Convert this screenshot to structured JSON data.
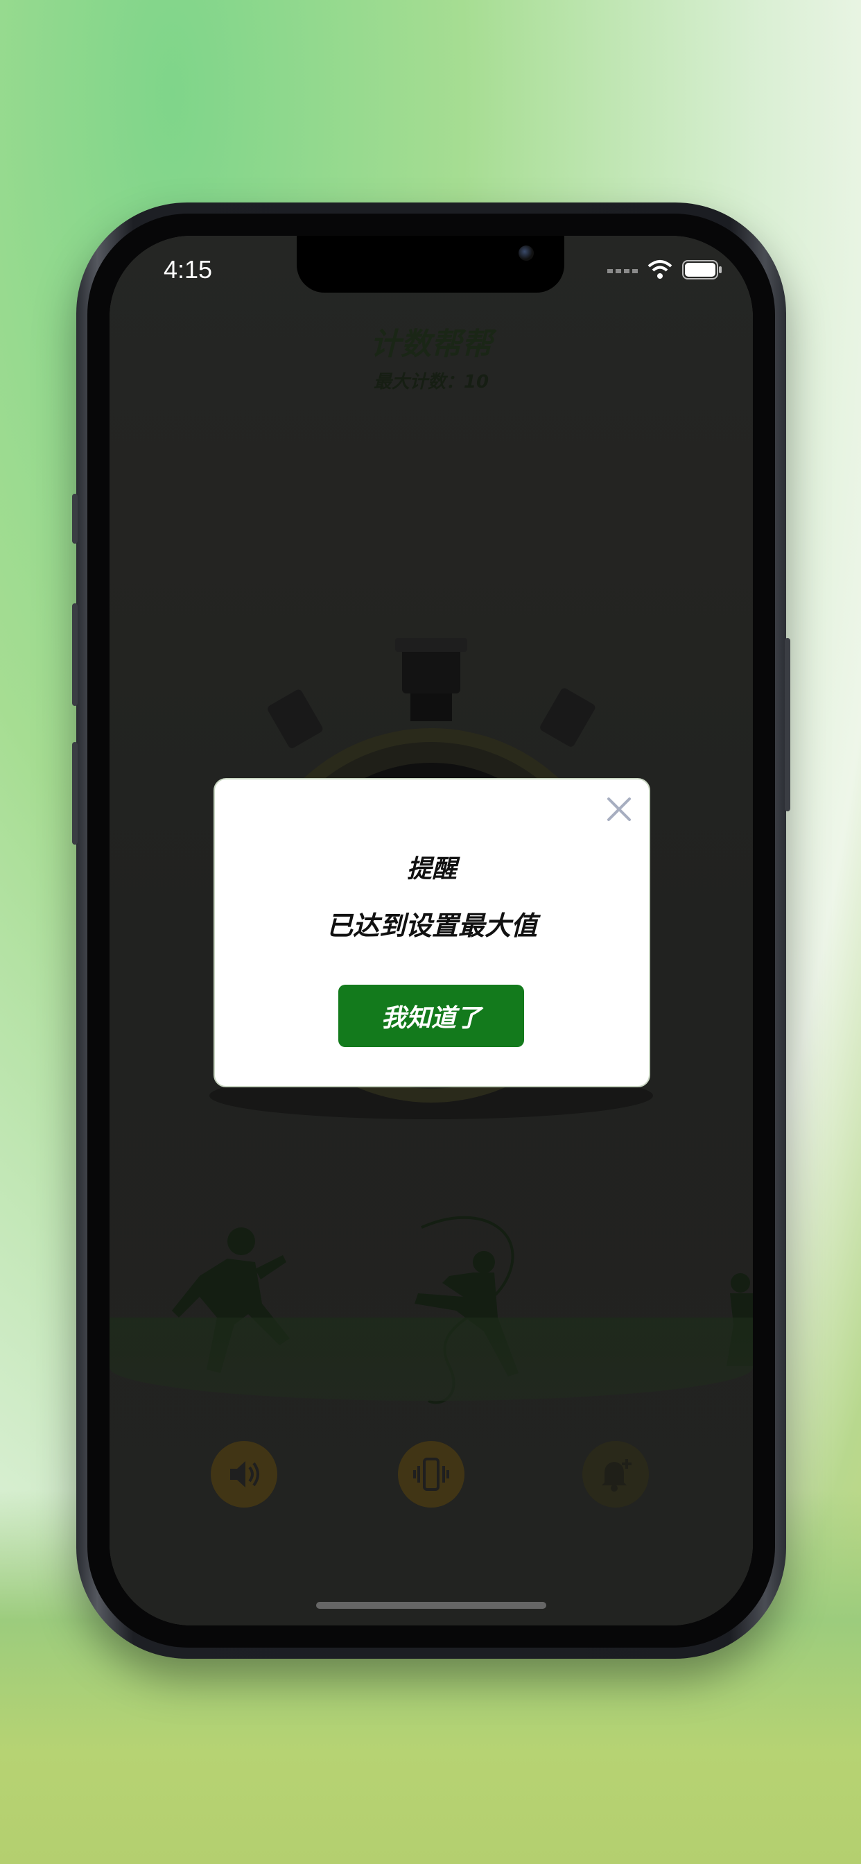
{
  "status_bar": {
    "time": "4:15"
  },
  "app": {
    "title": "计数帮帮",
    "subtitle": "最大计数：10"
  },
  "dialog": {
    "title": "提醒",
    "message": "已达到设置最大值",
    "confirm_label": "我知道了"
  },
  "toolbar": {
    "items": [
      {
        "icon": "speaker-icon"
      },
      {
        "icon": "vibrate-icon"
      },
      {
        "icon": "bell-add-icon"
      }
    ]
  },
  "colors": {
    "accent_green": "#137a1c",
    "overlay": "rgba(0,0,0,0.28)",
    "dialog_bg": "#ffffff"
  }
}
